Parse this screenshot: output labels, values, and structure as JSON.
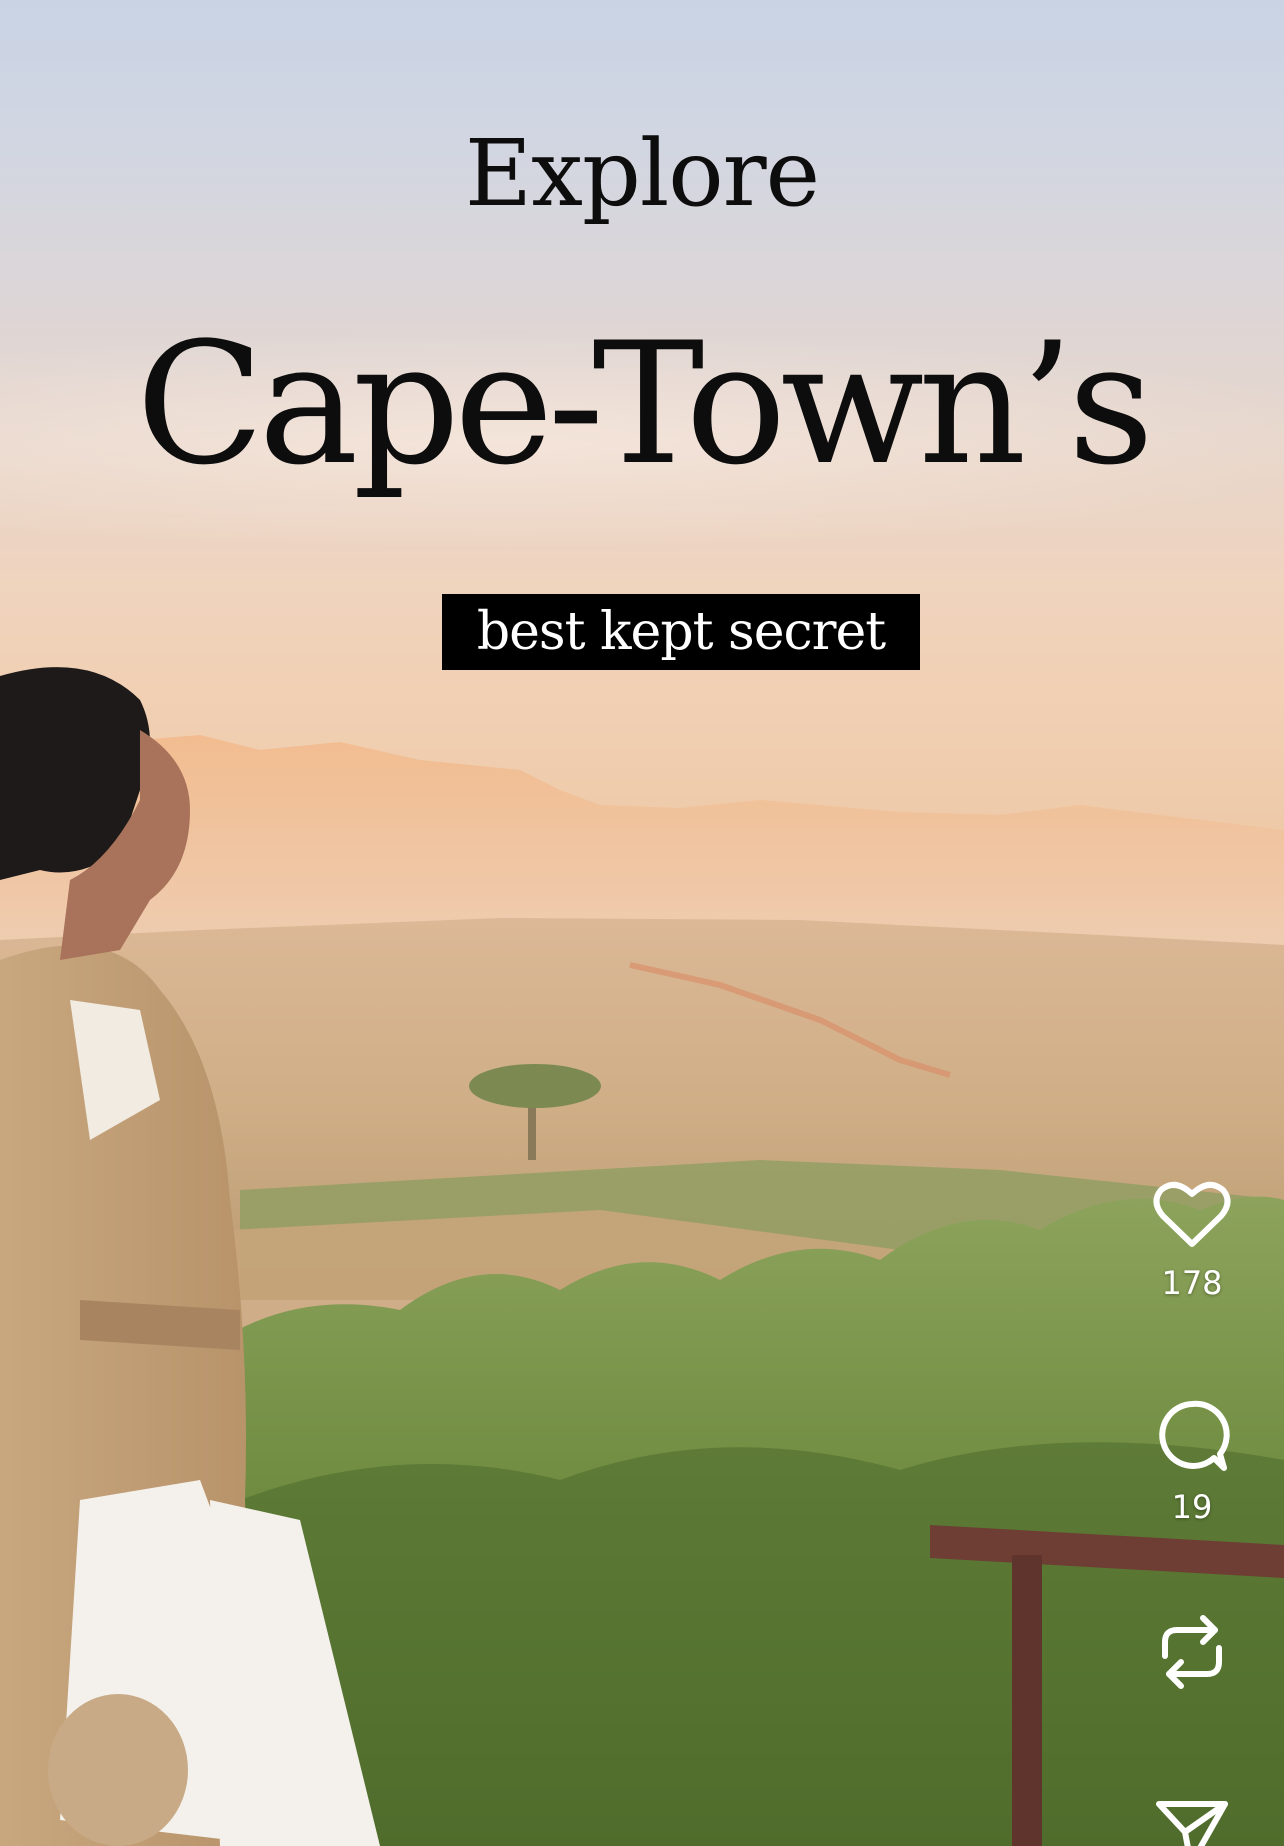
{
  "overlay": {
    "line1": "Explore",
    "line2": "Cape-Town’s",
    "tagline": "best kept secret"
  },
  "actions": {
    "like": {
      "icon": "heart-icon",
      "count": "178"
    },
    "comment": {
      "icon": "comment-icon",
      "count": "19"
    },
    "repost": {
      "icon": "repost-icon"
    },
    "share": {
      "icon": "send-icon"
    }
  },
  "colors": {
    "title_text": "#0d0d0d",
    "tagline_bg": "#000000",
    "tagline_text": "#ffffff",
    "icon": "#ffffff"
  }
}
